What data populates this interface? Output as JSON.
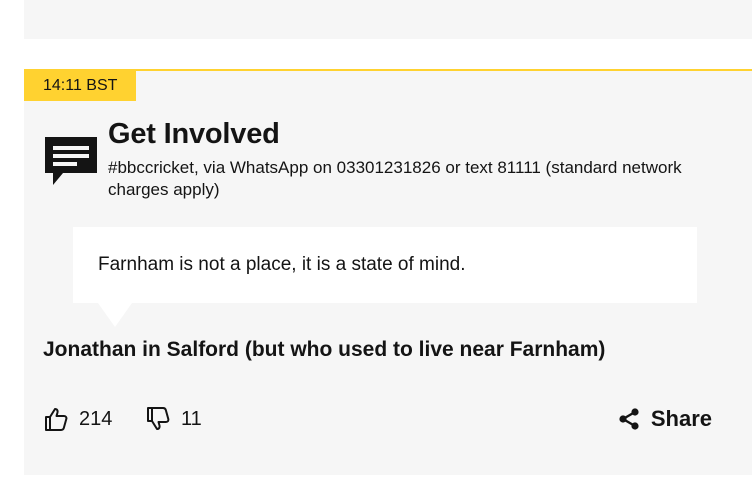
{
  "post": {
    "timestamp": "14:11 BST",
    "get_involved": {
      "icon": "speech-bubble-icon",
      "title": "Get Involved",
      "description": "#bbccricket, via WhatsApp on 03301231826 or text 81111 (standard network charges apply)"
    },
    "quote": "Farnham is not a place, it is a state of mind.",
    "attribution": "Jonathan in Salford (but who used to live near Farnham)",
    "reactions": {
      "likes": "214",
      "dislikes": "11",
      "like_icon": "thumbs-up-icon",
      "dislike_icon": "thumbs-down-icon"
    },
    "share_label": "Share",
    "share_icon": "share-icon"
  },
  "colors": {
    "accent": "#ffd230",
    "card_background": "#f6f6f6",
    "text": "#141414"
  }
}
